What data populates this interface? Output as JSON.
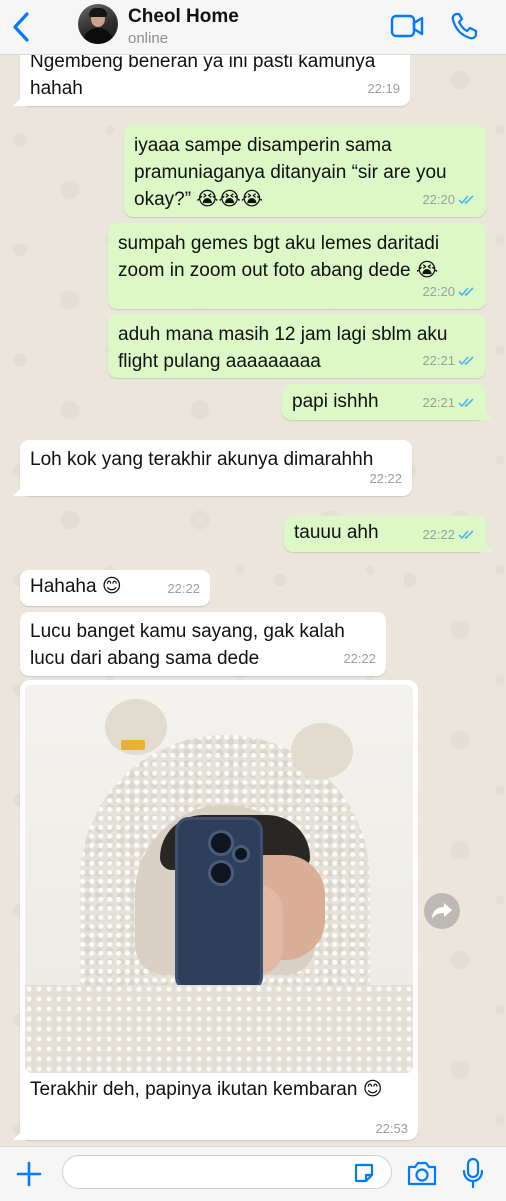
{
  "header": {
    "contact_name": "Cheol Home",
    "status": "online"
  },
  "messages": [
    {
      "direction": "in",
      "text": "Ngembeng beneran ya ini pasti kamunya hahah",
      "time": "22:19"
    },
    {
      "direction": "out",
      "text": "iyaaa sampe disamperin sama pramuniaganya ditanyain “sir are you okay?” 😭😭😭",
      "time": "22:20",
      "status": "read"
    },
    {
      "direction": "out",
      "text": "sumpah gemes bgt aku lemes daritadi zoom in zoom out foto abang dede 😭",
      "time": "22:20",
      "status": "read"
    },
    {
      "direction": "out",
      "text": "aduh mana masih 12 jam lagi sblm aku flight pulang aaaaaaaaa",
      "time": "22:21",
      "status": "read"
    },
    {
      "direction": "out",
      "text": "papi ishhh",
      "time": "22:21",
      "status": "read"
    },
    {
      "direction": "in",
      "text": "Loh kok yang terakhir akunya dimarahhh",
      "time": "22:22"
    },
    {
      "direction": "out",
      "text": "tauuu ahh",
      "time": "22:22",
      "status": "read"
    },
    {
      "direction": "in",
      "text": "Hahaha 😊",
      "time": "22:22"
    },
    {
      "direction": "in",
      "text": "Lucu banget kamu sayang, gak kalah lucu dari abang sama dede",
      "time": "22:22"
    },
    {
      "direction": "in",
      "type": "photo",
      "caption": "Terakhir deh, papinya ikutan kembaran 😊",
      "time": "22:53"
    }
  ],
  "colors": {
    "accent": "#007aff",
    "outgoing_bubble": "#dcf8c6",
    "incoming_bubble": "#ffffff",
    "read_ticks": "#4fb6ec"
  },
  "icons": {
    "back": "chevron-left-icon",
    "video": "video-camera-icon",
    "call": "phone-icon",
    "forward": "forward-arrow-icon",
    "plus": "plus-icon",
    "sticker": "sticker-icon",
    "camera": "camera-icon",
    "mic": "microphone-icon"
  },
  "input": {
    "placeholder": ""
  }
}
